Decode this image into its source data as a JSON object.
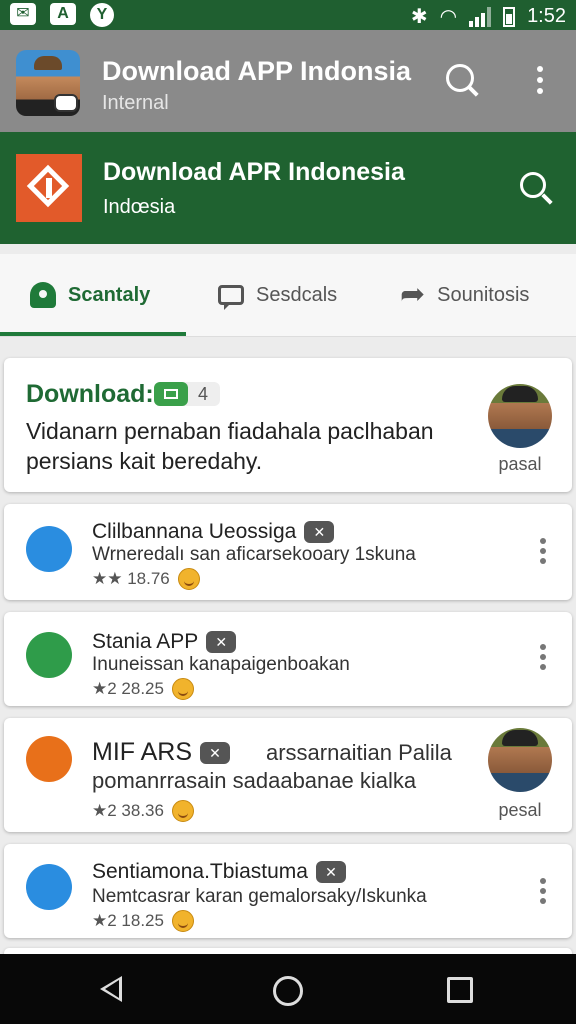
{
  "status": {
    "time": "1:52"
  },
  "appbar_top": {
    "title": "Download APP Indonsia",
    "subtitle": "Internal"
  },
  "appbar_main": {
    "title": "Download APR Indonesia",
    "subtitle": "Indœsia"
  },
  "tabs": [
    {
      "label": "Scantaly",
      "icon": "pin-icon",
      "active": true
    },
    {
      "label": "Sesdcals",
      "icon": "chat-icon",
      "active": false
    },
    {
      "label": "Sounitosis",
      "icon": "share-icon",
      "active": false
    }
  ],
  "featured": {
    "title": "Download:",
    "count": "4",
    "body": "Vidanarn pernaban fiadahala paclhaban persians kait beredahy.",
    "person_label": "pasal"
  },
  "apps": [
    {
      "name": "Clilbannana Ueossiga",
      "desc": "Wrneredalı san aficarsekooary 1skuna",
      "rating": "★★ 18.76",
      "icon_color": "#2a8de0",
      "icon": "chat-bubble-icon"
    },
    {
      "name": "Stania APP",
      "desc": "Inuneissan kanapaigenboakan",
      "rating": "★2 28.25",
      "icon_color": "#2f9c4a",
      "icon": "screen-icon"
    },
    {
      "name": "MIF ARS",
      "desc_line1": "arssarnaitian Palila",
      "desc": "pomanrrasain sadaabanae kialka",
      "rating": "★2 38.36",
      "icon_color": "#e8701a",
      "icon": "toggle-icon",
      "person_label": "pesal"
    },
    {
      "name": "Sentiamona.Tbiastuma",
      "desc": "Nemtcasrar karan gemalorsaky/Iskunka",
      "rating": "★2 18.25",
      "icon_color": "#2a8de0",
      "icon": "robot-icon"
    }
  ],
  "badge_x": "✕"
}
